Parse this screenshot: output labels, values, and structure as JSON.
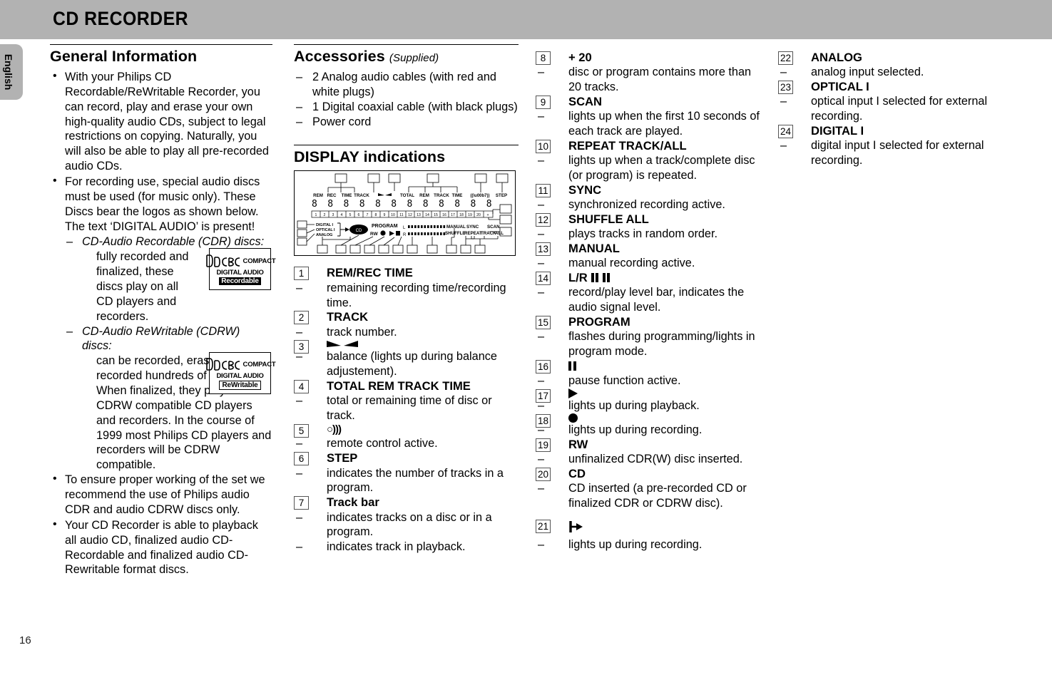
{
  "header": {
    "title": "CD RECORDER"
  },
  "language_tab": "English",
  "page_number": "16",
  "general": {
    "heading": "General Information",
    "bullets": [
      "With your Philips CD Recordable/ReWritable Recorder, you can record, play and erase your own high-quality audio CDs, subject to legal restrictions on copying. Naturally, you will also be able to play all pre-recorded audio CDs.",
      "For recording use, special audio discs must be used (for music only). These Discs bear the logos as shown below. The text ‘DIGITAL AUDIO’ is present!"
    ],
    "sub_items": [
      {
        "title": "CD-Audio Recordable (CDR) discs:",
        "body": "fully recorded and finalized, these discs play on all CD players and recorders.",
        "logo": {
          "compact": "COMPACT",
          "disc": "disc",
          "digital_audio": "DIGITAL AUDIO",
          "tagline": "Recordable",
          "tagline_style": "inverted"
        }
      },
      {
        "title": "CD-Audio ReWritable (CDRW) discs:",
        "body": "can be recorded, erased and re-recorded hundreds of times. When finalized, they play on CDRW compatible CD players and recorders. In the course of 1999 most Philips CD players and recorders will be CDRW compatible.",
        "logo": {
          "compact": "COMPACT",
          "disc": "disc",
          "digital_audio": "DIGITAL AUDIO",
          "tagline": "ReWritable",
          "tagline_style": "outline"
        }
      }
    ],
    "bullets_tail": [
      "To ensure proper working of the set we recommend the use of Philips audio CDR and audio CDRW discs only.",
      "Your CD Recorder is able to playback all audio CD,  finalized audio CD-Recordable and finalized audio CD-Rewritable format discs."
    ]
  },
  "accessories": {
    "heading": "Accessories",
    "heading_suffix": "(Supplied)",
    "items": [
      "2 Analog audio cables (with red and white plugs)",
      "1 Digital coaxial cable (with black plugs)",
      "Power cord"
    ]
  },
  "display": {
    "heading": "DISPLAY indications",
    "figure_labels": {
      "top_row": [
        "REM",
        "REC",
        "TIME",
        "TRACK",
        "TOTAL",
        "REM",
        "TRACK",
        "TIME",
        "STEP"
      ],
      "remote_glyph": "((·))",
      "track_bar_numbers": [
        "1",
        "2",
        "3",
        "4",
        "5",
        "6",
        "7",
        "8",
        "9",
        "10",
        "11",
        "12",
        "13",
        "14",
        "15",
        "16",
        "17",
        "18",
        "19",
        "20",
        "+"
      ],
      "left_inputs": [
        "DIGITAL I",
        "OPTICAL I",
        "ANALOG"
      ],
      "center": [
        "CD",
        "RW",
        "PROGRAM",
        "L",
        "R"
      ],
      "right": [
        "MANUAL",
        "SHUFFLE",
        "SYNC",
        "REPEAT",
        "TRACK",
        "ALL",
        "SCAN"
      ]
    }
  },
  "indications": [
    {
      "n": "1",
      "title": "REM/REC TIME",
      "icon": null,
      "desc": [
        "remaining recording time/recording time."
      ]
    },
    {
      "n": "2",
      "title": "TRACK",
      "icon": null,
      "desc": [
        "track number."
      ]
    },
    {
      "n": "3",
      "title": "",
      "icon": "balance-icon",
      "desc": [
        "balance (lights up during balance adjustement)."
      ]
    },
    {
      "n": "4",
      "title": "TOTAL REM TRACK TIME",
      "icon": null,
      "desc": [
        "total or remaining time of disc or track."
      ]
    },
    {
      "n": "5",
      "title": "",
      "icon": "remote-icon",
      "icon_text": "○)))",
      "desc": [
        "remote control active."
      ]
    },
    {
      "n": "6",
      "title": "STEP",
      "icon": null,
      "desc": [
        "indicates the number of tracks in a program."
      ]
    },
    {
      "n": "7",
      "title": "Track bar",
      "icon": null,
      "desc": [
        "indicates tracks on a disc or in a program.",
        "indicates track in playback."
      ]
    },
    {
      "n": "8",
      "title": "+ 20",
      "icon": null,
      "desc": [
        "disc or program contains more than 20 tracks."
      ]
    },
    {
      "n": "9",
      "title": "SCAN",
      "icon": null,
      "desc": [
        "lights up when the first 10 seconds of each track are played."
      ]
    },
    {
      "n": "10",
      "title": "REPEAT TRACK/ALL",
      "icon": null,
      "desc": [
        "lights up when a track/complete disc (or program) is repeated."
      ]
    },
    {
      "n": "11",
      "title": "SYNC",
      "icon": null,
      "desc": [
        "synchronized recording active."
      ]
    },
    {
      "n": "12",
      "title": "SHUFFLE ALL",
      "icon": null,
      "desc": [
        "plays tracks in random order."
      ]
    },
    {
      "n": "13",
      "title": "MANUAL",
      "icon": null,
      "desc": [
        "manual recording active."
      ]
    },
    {
      "n": "14",
      "title": "L/R",
      "icon": "level-bars-icon",
      "desc": [
        "record/play level bar, indicates the audio signal level."
      ]
    },
    {
      "n": "15",
      "title": "PROGRAM",
      "icon": null,
      "desc": [
        "flashes during programming/lights in program mode."
      ]
    },
    {
      "n": "16",
      "title": "",
      "icon": "pause-icon",
      "desc": [
        "pause function active."
      ]
    },
    {
      "n": "17",
      "title": "",
      "icon": "play-icon",
      "desc": [
        "lights up during playback."
      ]
    },
    {
      "n": "18",
      "title": "",
      "icon": "record-dot-icon",
      "desc": [
        "lights up during recording."
      ]
    },
    {
      "n": "19",
      "title": "RW",
      "icon": null,
      "desc": [
        "unfinalized CDR(W) disc inserted."
      ]
    },
    {
      "n": "20",
      "title": "CD",
      "icon": null,
      "desc": [
        "CD inserted (a pre-recorded CD or finalized CDR or CDRW disc)."
      ]
    },
    {
      "n": "21",
      "title": "",
      "icon": "output-arrow-icon",
      "desc": [
        "lights up during recording."
      ]
    },
    {
      "n": "22",
      "title": "ANALOG",
      "icon": null,
      "desc": [
        "analog input selected."
      ]
    },
    {
      "n": "23",
      "title": "OPTICAL  I",
      "icon": null,
      "desc": [
        "optical input I selected for external recording."
      ]
    },
    {
      "n": "24",
      "title": "DIGITAL  I",
      "icon": null,
      "desc": [
        "digital input I selected for external recording."
      ]
    }
  ]
}
